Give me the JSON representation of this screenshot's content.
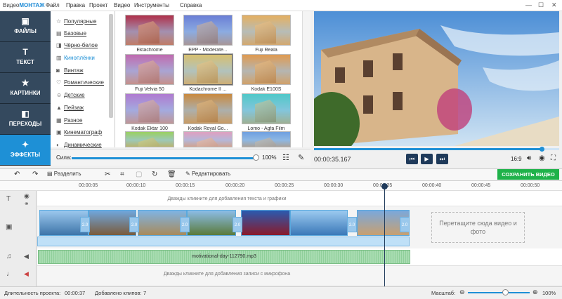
{
  "app": {
    "name_prefix": "Видео",
    "name_suffix": "МОНТАЖ"
  },
  "menu": [
    "Файл",
    "Правка",
    "Проект",
    "Видео",
    "Инструменты",
    "Справка"
  ],
  "window": {
    "minimize": "—",
    "maximize": "☐",
    "close": "✕"
  },
  "nav": [
    {
      "label": "ФАЙЛЫ",
      "icon": "folder-icon"
    },
    {
      "label": "ТЕКСТ",
      "icon": "text-icon"
    },
    {
      "label": "КАРТИНКИ",
      "icon": "star-icon"
    },
    {
      "label": "ПЕРЕХОДЫ",
      "icon": "transitions-icon"
    },
    {
      "label": "ЭФФЕКТЫ",
      "icon": "wand-icon"
    }
  ],
  "categories": [
    {
      "label": "Популярные",
      "icon": "star-outline-icon"
    },
    {
      "label": "Базовые",
      "icon": "square-icon"
    },
    {
      "label": "Чёрно-белое",
      "icon": "bw-icon"
    },
    {
      "label": "Киноплёнки",
      "icon": "film-icon"
    },
    {
      "label": "Винтаж",
      "icon": "camera-icon"
    },
    {
      "label": "Романтические",
      "icon": "heart-icon"
    },
    {
      "label": "Детские",
      "icon": "bear-icon"
    },
    {
      "label": "Пейзаж",
      "icon": "landscape-icon"
    },
    {
      "label": "Разное",
      "icon": "misc-icon"
    },
    {
      "label": "Кинематограф",
      "icon": "clapper-icon"
    },
    {
      "label": "Динамические",
      "icon": "dynamic-icon"
    }
  ],
  "effects": [
    {
      "label": "Ektachrome",
      "tint": "#b0304a"
    },
    {
      "label": "EPP - Moderate...",
      "tint": "#6a7fd6"
    },
    {
      "label": "Fuji Reala",
      "tint": "#e4b060"
    },
    {
      "label": "Fuji Velvia 50",
      "tint": "#c06ab0"
    },
    {
      "label": "Kodachrome II ...",
      "tint": "#d8c070"
    },
    {
      "label": "Kodak E100S",
      "tint": "#e09a50"
    },
    {
      "label": "Kodak Ektar 100",
      "tint": "#b07ad0"
    },
    {
      "label": "Kodak Royal Go...",
      "tint": "#c98a40"
    },
    {
      "label": "Lomo - Agfa Film",
      "tint": "#50c8c8"
    },
    {
      "label": "",
      "tint": "#9ad060"
    },
    {
      "label": "",
      "tint": "#e0a0c0"
    },
    {
      "label": "",
      "tint": "#70a0e0"
    }
  ],
  "strength": {
    "label": "Сила:",
    "value": "100%",
    "level": 1.0
  },
  "player": {
    "time": "00:00:35.167",
    "ratio": "16:9",
    "progress": 0.93
  },
  "toolbar": {
    "split": "Разделить",
    "edit": "Редактировать",
    "save": "СОХРАНИТЬ ВИДЕО"
  },
  "ruler": [
    "00:00:05",
    "00:00:10",
    "00:00:15",
    "00:00:20",
    "00:00:25",
    "00:00:30",
    "00:00:35",
    "00:00:40",
    "00:00:45",
    "00:00:50"
  ],
  "tracks": {
    "text_hint": "Дважды кликните для добавления текста и графики",
    "transition_label": "2.0",
    "drop_hint": "Перетащите сюда видео и фото",
    "audio_file": "motivational-day-112790.mp3",
    "mic_hint": "Дважды кликните для добавления записи с микрофона"
  },
  "status": {
    "duration_label": "Длительность проекта:",
    "duration": "00:00:37",
    "clips_label": "Добавлено клипов:",
    "clips": "7",
    "zoom_label": "Масштаб:",
    "zoom_minus": "⊖",
    "zoom_plus": "⊕",
    "zoom_value": "100%"
  }
}
